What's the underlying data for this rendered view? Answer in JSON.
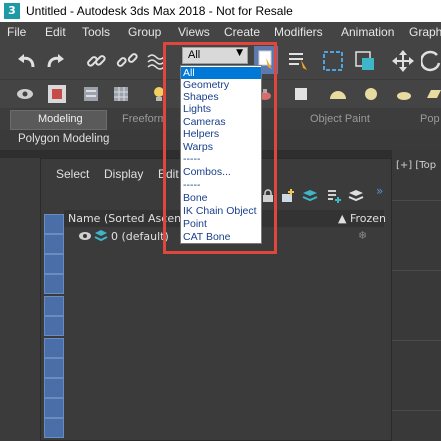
{
  "titlebar": {
    "title": "Untitled - Autodesk 3ds Max 2018 - Not for Resale",
    "icon": "3"
  },
  "menubar": {
    "items": [
      "File",
      "Edit",
      "Tools",
      "Group",
      "Views",
      "Create",
      "Modifiers",
      "Animation",
      "Graph"
    ]
  },
  "selection_filter": {
    "selected": "All",
    "options": [
      "All",
      "Geometry",
      "Shapes",
      "Lights",
      "Cameras",
      "Helpers",
      "Warps",
      "-----",
      "Combos...",
      "-----",
      "Bone",
      "IK Chain Object",
      "Point",
      "CAT Bone"
    ]
  },
  "ribbon": {
    "tabs": [
      "Modeling",
      "Freeform",
      "Object Paint",
      "Pop"
    ],
    "subtab": "Polygon Modeling"
  },
  "scene_explorer": {
    "menu": [
      "Select",
      "Display",
      "Edit"
    ],
    "column_name": "Name (Sorted Ascending",
    "column_frozen": "▲ Frozen",
    "layer": "0 (default)"
  },
  "viewport": {
    "label": "[+] [Top"
  },
  "colors": {
    "highlight": "#e0463c",
    "dropdown_text": "#1a3f8c",
    "selected_bg": "#0078d7"
  }
}
